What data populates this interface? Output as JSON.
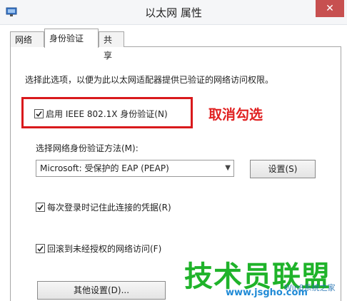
{
  "window": {
    "title": "以太网 属性",
    "close_label": "✕"
  },
  "tabs": [
    {
      "label": "网络",
      "active": false
    },
    {
      "label": "身份验证",
      "active": true
    },
    {
      "label": "共享",
      "active": false
    }
  ],
  "auth": {
    "description": "选择此选项，以便为此以太网适配器提供已验证的网络访问权限。",
    "enable_8021x": {
      "label": "启用 IEEE 802.1X 身份验证(N)",
      "checked": true
    },
    "method_label": "选择网络身份验证方法(M):",
    "method_selected": "Microsoft: 受保护的 EAP (PEAP)",
    "settings_button": "设置(S)",
    "remember_credentials": {
      "label": "每次登录时记住此连接的凭据(R)",
      "checked": true
    },
    "fallback_unauthorized": {
      "label": "回滚到未经授权的网络访问(F)",
      "checked": true
    },
    "other_settings_button": "其他设置(D)..."
  },
  "annotation": {
    "text": "取消勾选",
    "color": "#e02020"
  },
  "watermark": {
    "main": "技术员联盟",
    "url": "www.jsgho.com",
    "sub": "Win8系统之家"
  },
  "colors": {
    "highlight_border": "#d9191c",
    "watermark_green": "#1fb32a",
    "watermark_blue": "#1f8ad6",
    "close_button": "#c75050"
  }
}
